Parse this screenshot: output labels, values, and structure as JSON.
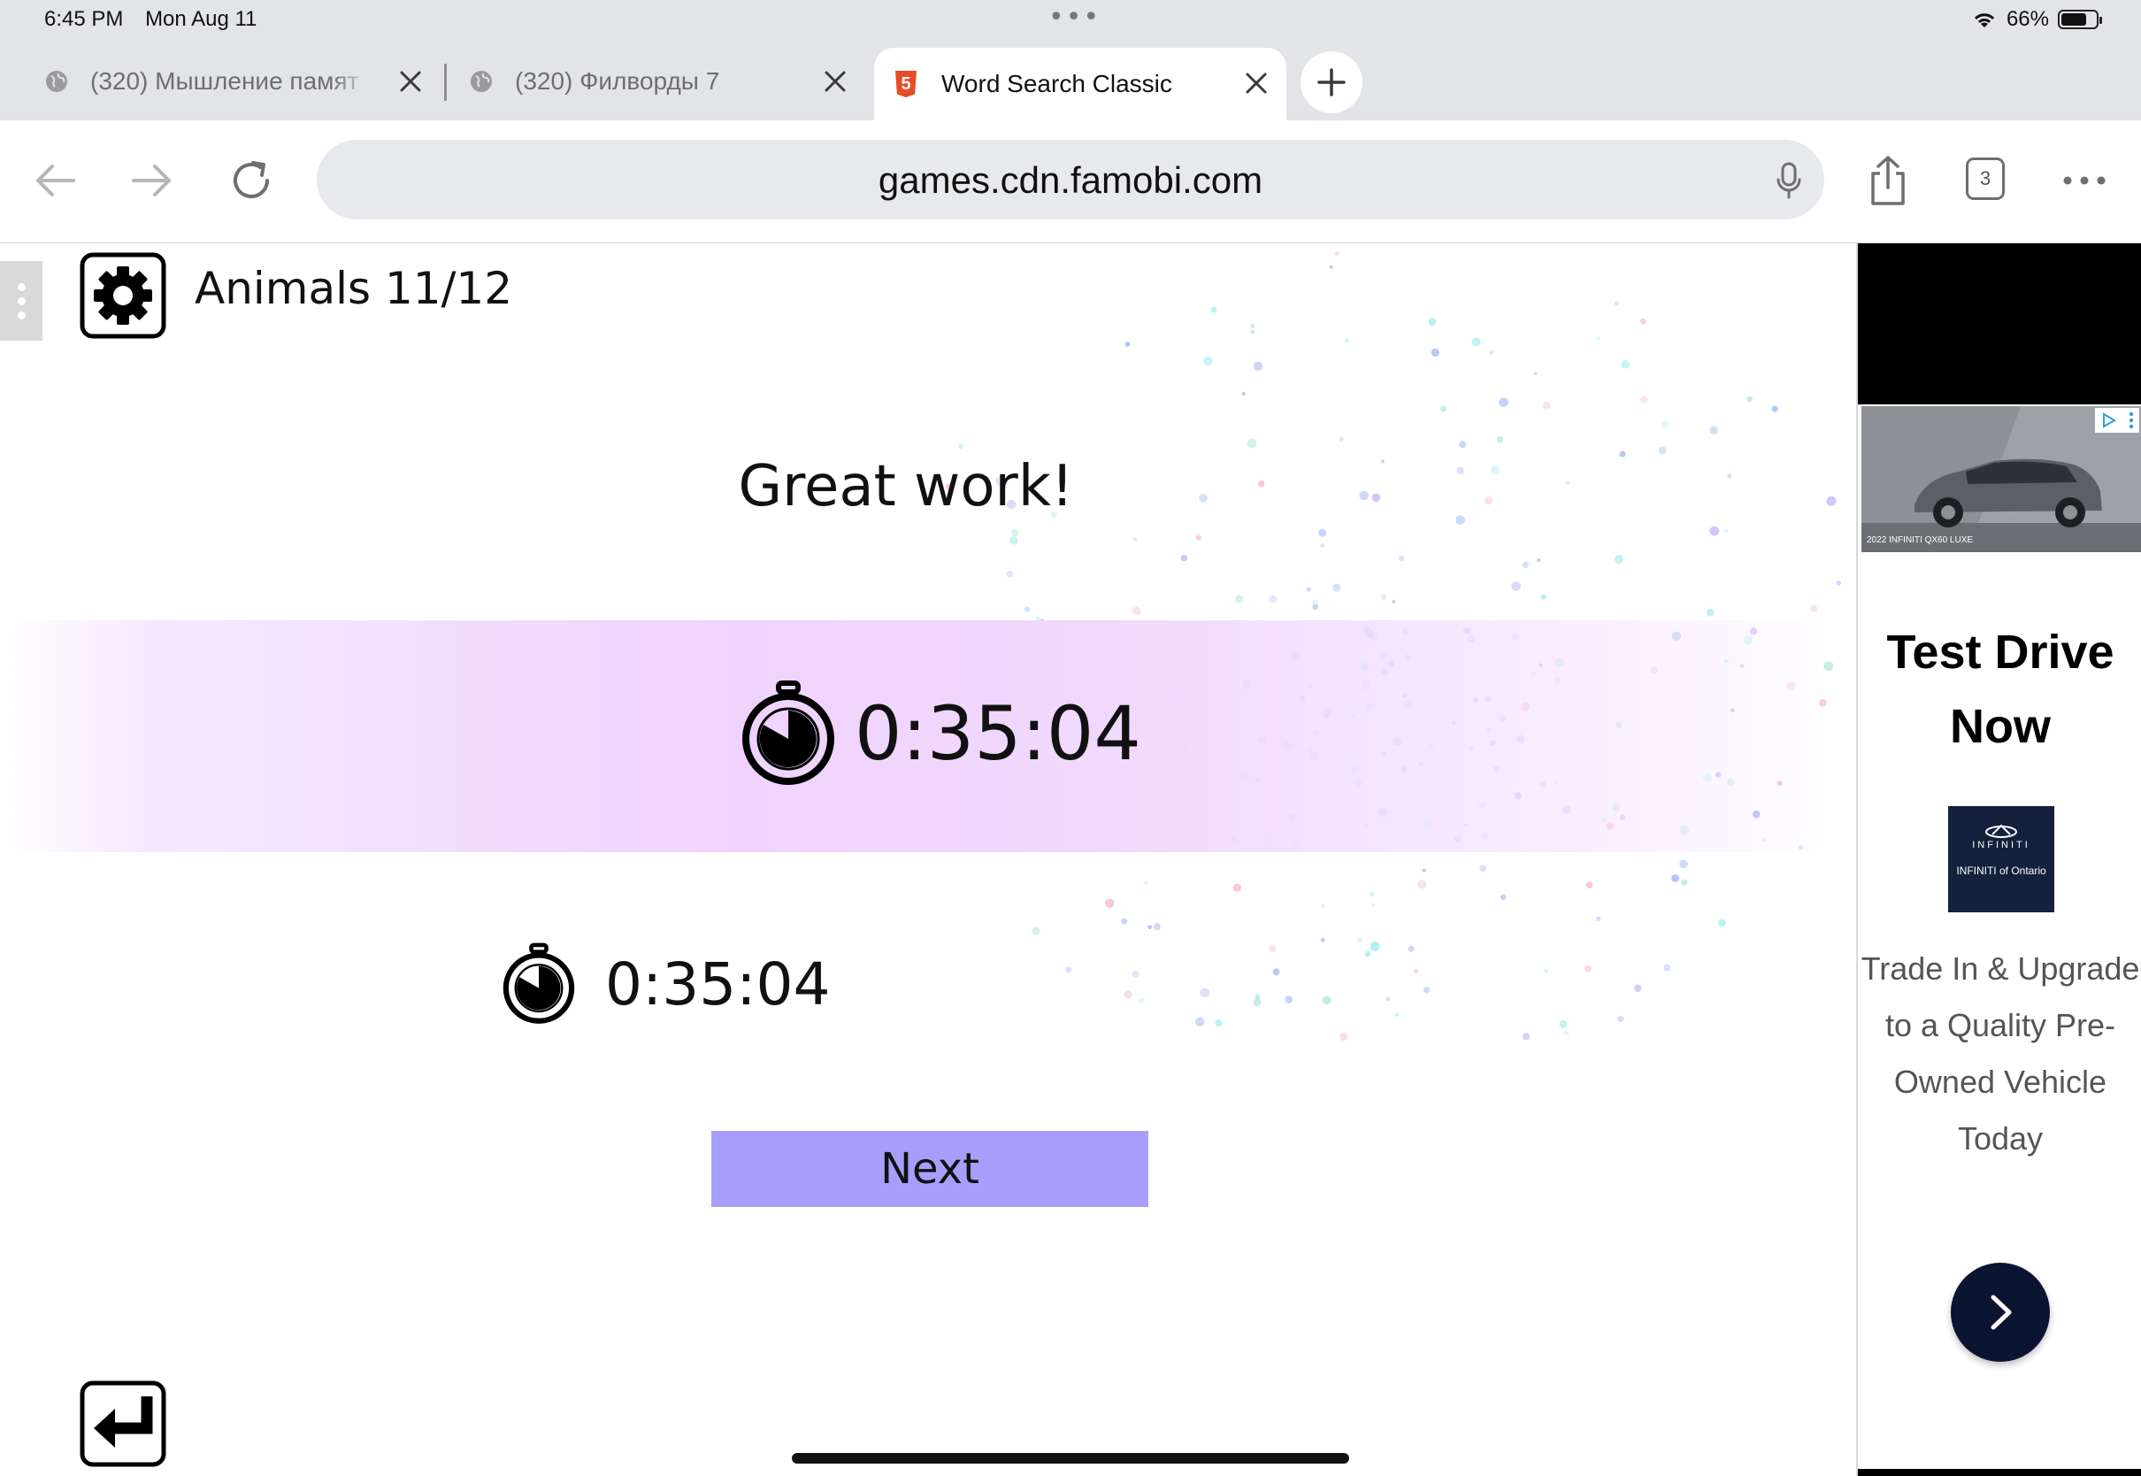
{
  "status_bar": {
    "time": "6:45 PM",
    "date": "Mon Aug 11",
    "battery_percent": "66%",
    "battery_level": 0.66
  },
  "tabs": [
    {
      "title": "(320) Мышление памят",
      "active": false
    },
    {
      "title": "(320) Филворды 7",
      "active": false
    },
    {
      "title": "Word Search Classic",
      "active": true
    }
  ],
  "toolbar": {
    "url": "games.cdn.famobi.com",
    "tab_count": "3"
  },
  "game": {
    "level": "Animals 11/12",
    "headline": "Great work!",
    "time": "0:35:04",
    "best_time": "0:35:04",
    "next_label": "Next"
  },
  "ad": {
    "image_caption": "2022 INFINITI QX60 LUXE",
    "headline": "Test Drive Now",
    "logo_brand": "INFINITI",
    "logo_dealer": "INFINITI of Ontario",
    "body": "Trade In & Upgrade to a Quality Pre-Owned Vehicle Today"
  },
  "colors": {
    "next_button": "#a99dfc",
    "time_band": "#efd3fd",
    "ad_cta": "#0b1430",
    "favicon": "#e44d26"
  },
  "icons": [
    "globe-icon",
    "close-icon",
    "plus-icon",
    "back-arrow-icon",
    "forward-arrow-icon",
    "reload-icon",
    "mic-icon",
    "share-icon",
    "more-icon",
    "gear-icon",
    "stopwatch-icon",
    "return-arrow-icon",
    "chevron-right-icon",
    "wifi-icon",
    "battery-icon"
  ]
}
